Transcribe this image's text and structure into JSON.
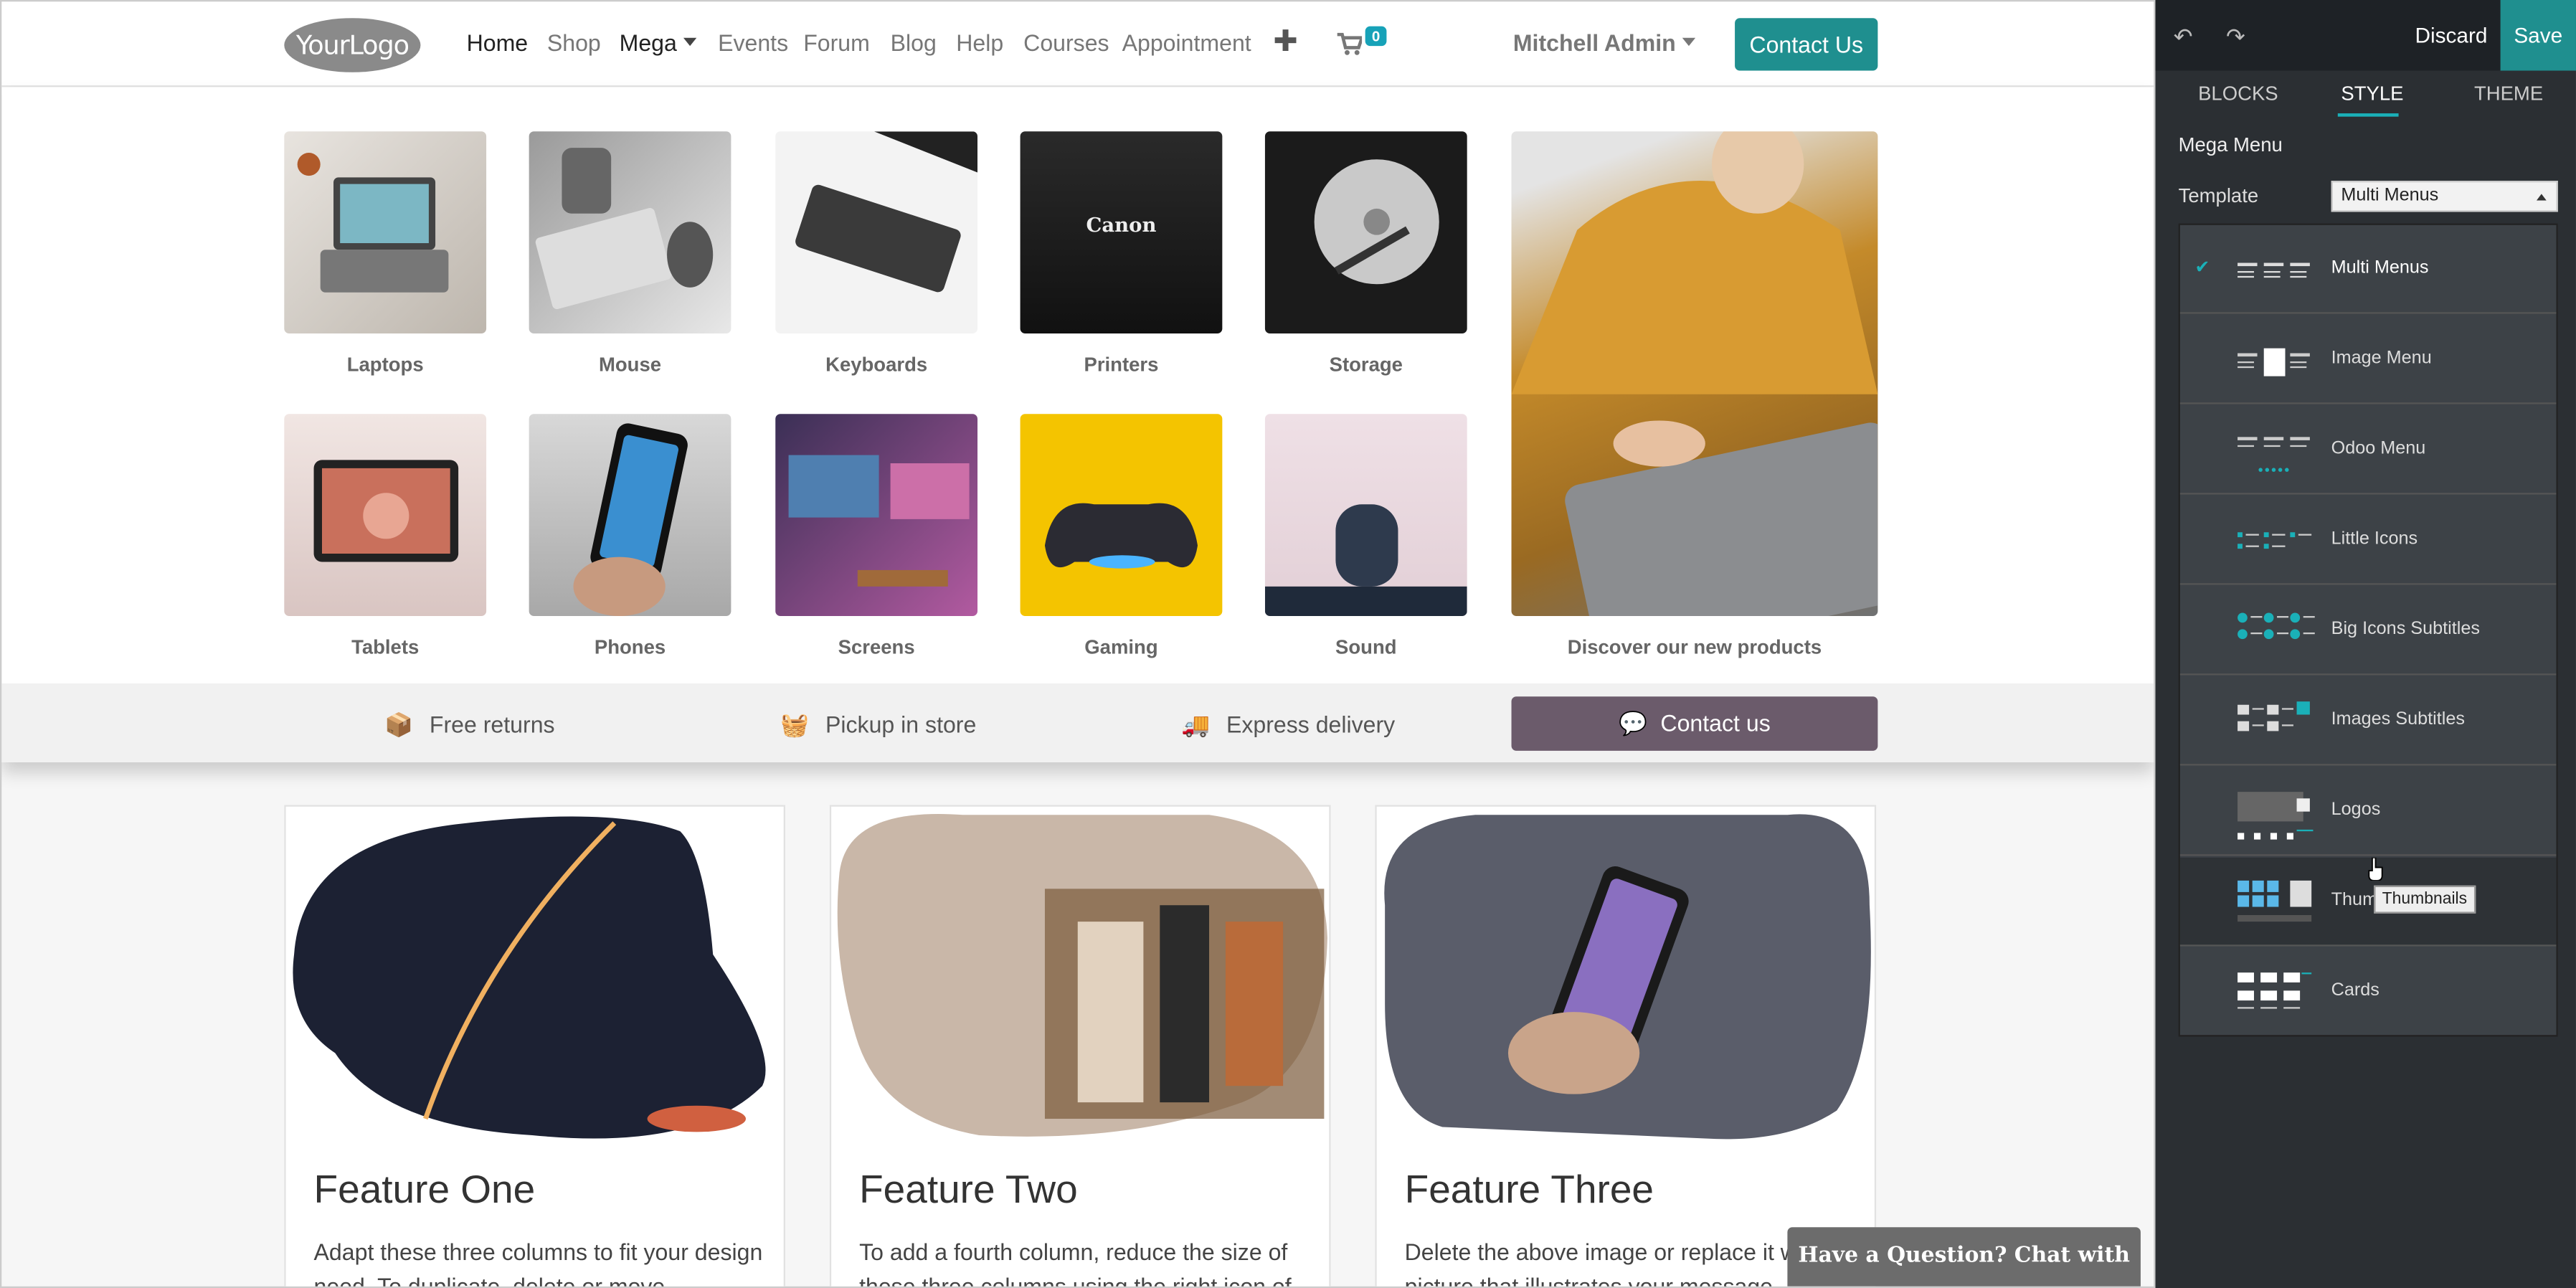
{
  "navbar": {
    "logo_text": "YourLogo",
    "items": [
      "Home",
      "Shop",
      "Mega",
      "Events",
      "Forum",
      "Blog",
      "Help",
      "Courses",
      "Appointment"
    ],
    "cart_count": "0",
    "user": "Mitchell Admin",
    "contact_label": "Contact Us"
  },
  "mega_menu": {
    "row1": [
      "Laptops",
      "Mouse",
      "Keyboards",
      "Printers",
      "Storage"
    ],
    "row2": [
      "Tablets",
      "Phones",
      "Screens",
      "Gaming",
      "Sound"
    ],
    "featured_caption": "Discover our new products",
    "printer_brand": "Canon",
    "bottom_bar": {
      "free_returns": "Free returns",
      "pickup": "Pickup in store",
      "express": "Express delivery",
      "contact": "Contact us"
    }
  },
  "features": [
    {
      "title": "Feature One",
      "text": "Adapt these three columns to fit your design need. To duplicate, delete or move"
    },
    {
      "title": "Feature Two",
      "text": "To add a fourth column, reduce the size of these three columns using the right icon of"
    },
    {
      "title": "Feature Three",
      "text": "Delete the above image or replace it with a picture that illustrates your message."
    }
  ],
  "chat_label": "Have a Question? Chat with us.",
  "editor": {
    "discard_label": "Discard",
    "save_label": "Save",
    "tabs": [
      "BLOCKS",
      "STYLE",
      "THEME"
    ],
    "section_title": "Mega Menu",
    "template_label": "Template",
    "template_value": "Multi Menus",
    "options": [
      "Multi Menus",
      "Image Menu",
      "Odoo Menu",
      "Little Icons",
      "Big Icons Subtitles",
      "Images Subtitles",
      "Logos",
      "Thum",
      "Cards"
    ],
    "tooltip": "Thumbnails"
  },
  "colors": {
    "accent": "#1f8f8f",
    "panel_bg": "#2b2f33",
    "contact_us_bar": "#6b5b6b"
  }
}
